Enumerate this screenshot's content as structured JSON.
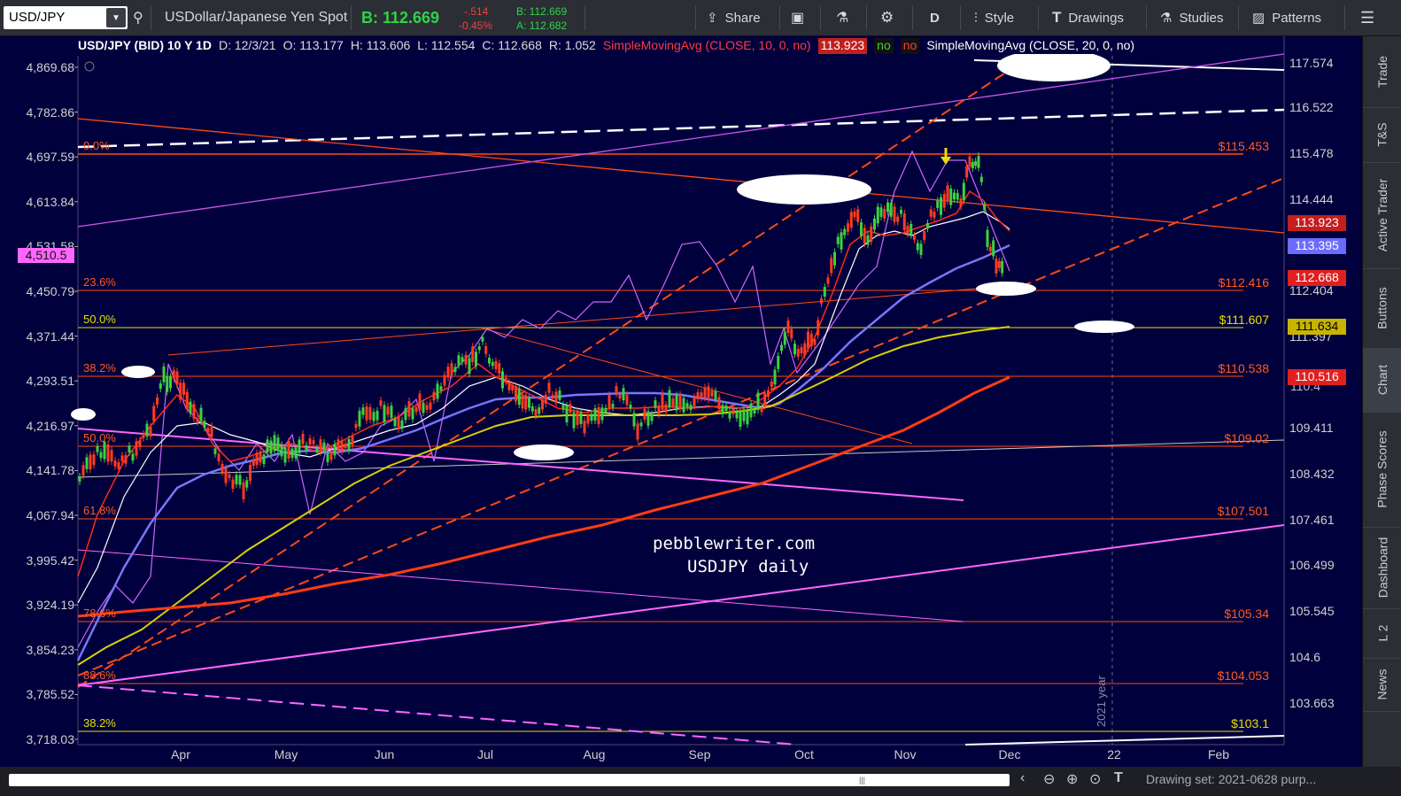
{
  "toolbar": {
    "symbol": "USD/JPY",
    "description": "USDollar/Japanese Yen Spot",
    "bid_label": "B: 112.669",
    "change": "-.514",
    "change_pct": "-0.45%",
    "bid_small": "B: 112.669",
    "ask_small": "A: 112.682",
    "share": "Share",
    "period": "D",
    "style": "Style",
    "drawings": "Drawings",
    "studies": "Studies",
    "patterns": "Patterns"
  },
  "chart": {
    "header_title": "USD/JPY (BID) 10 Y 1D",
    "header_date": "D: 12/3/21",
    "header_open": "O: 113.177",
    "header_high": "H: 113.606",
    "header_low": "L: 112.554",
    "header_close": "C: 112.668",
    "header_range": "R: 1.052",
    "study1": "SimpleMovingAvg (CLOSE, 10, 0, no)",
    "study1_val": "113.923",
    "flag_no1": "no",
    "flag_no2": "no",
    "study2": "SimpleMovingAvg (CLOSE, 20, 0, no)",
    "watermark1": "pebblewriter.com",
    "watermark2": "USDJPY daily",
    "year_label": "2021 year",
    "left_axis": [
      "4,869.68",
      "4,782.86",
      "4,697.59",
      "4,613.84",
      "4,531.58",
      "4,450.79",
      "4,371.44",
      "4,293.51",
      "4,216.97",
      "4,141.78",
      "4,067.94",
      "3,995.42",
      "3,924.19",
      "3,854.23",
      "3,785.52",
      "3,718.03"
    ],
    "left_badge": "4,510.5",
    "right_axis": [
      "117.574",
      "116.522",
      "115.478",
      "114.444",
      "112.404",
      "111.397",
      "109.411",
      "108.432",
      "107.461",
      "106.499",
      "105.545",
      "104.6",
      "103.663"
    ],
    "right_partial": "110.4",
    "price_badges": {
      "sma10": "113.923",
      "sma20": "113.395",
      "last": "112.668",
      "sma_yellow": "111.634",
      "sma_red": "110.516"
    },
    "months": [
      "Apr",
      "May",
      "Jun",
      "Jul",
      "Aug",
      "Sep",
      "Oct",
      "Nov",
      "Dec",
      "22",
      "Feb"
    ],
    "fib": [
      {
        "pct": "0.0%",
        "price": "$115.453"
      },
      {
        "pct": "23.6%",
        "price": "$112.416"
      },
      {
        "pct": "50.0%",
        "price": "$111.607"
      },
      {
        "pct": "38.2%",
        "price": "$110.538"
      },
      {
        "pct": "50.0%",
        "price": "$109.02"
      },
      {
        "pct": "61.8%",
        "price": "$107.501"
      },
      {
        "pct": "78.6%",
        "price": "$105.34"
      },
      {
        "pct": "88.6%",
        "price": "$104.053"
      },
      {
        "pct": "38.2%",
        "price": "$103.1"
      }
    ]
  },
  "sidebar": [
    "Trade",
    "T&S",
    "Active Trader",
    "Buttons",
    "Chart",
    "Phase Scores",
    "Dashboard",
    "L 2",
    "News"
  ],
  "bottom": {
    "drawing_set": "Drawing set: 2021-0628 purp..."
  },
  "colors": {
    "chart_bg": "#00003c",
    "fib": "#ff5a1e",
    "yellow": "#e6e000",
    "magenta": "#ff66ff",
    "sma_blue": "#7777ff",
    "up": "#3cd23c",
    "down": "#ff3c1e"
  }
}
